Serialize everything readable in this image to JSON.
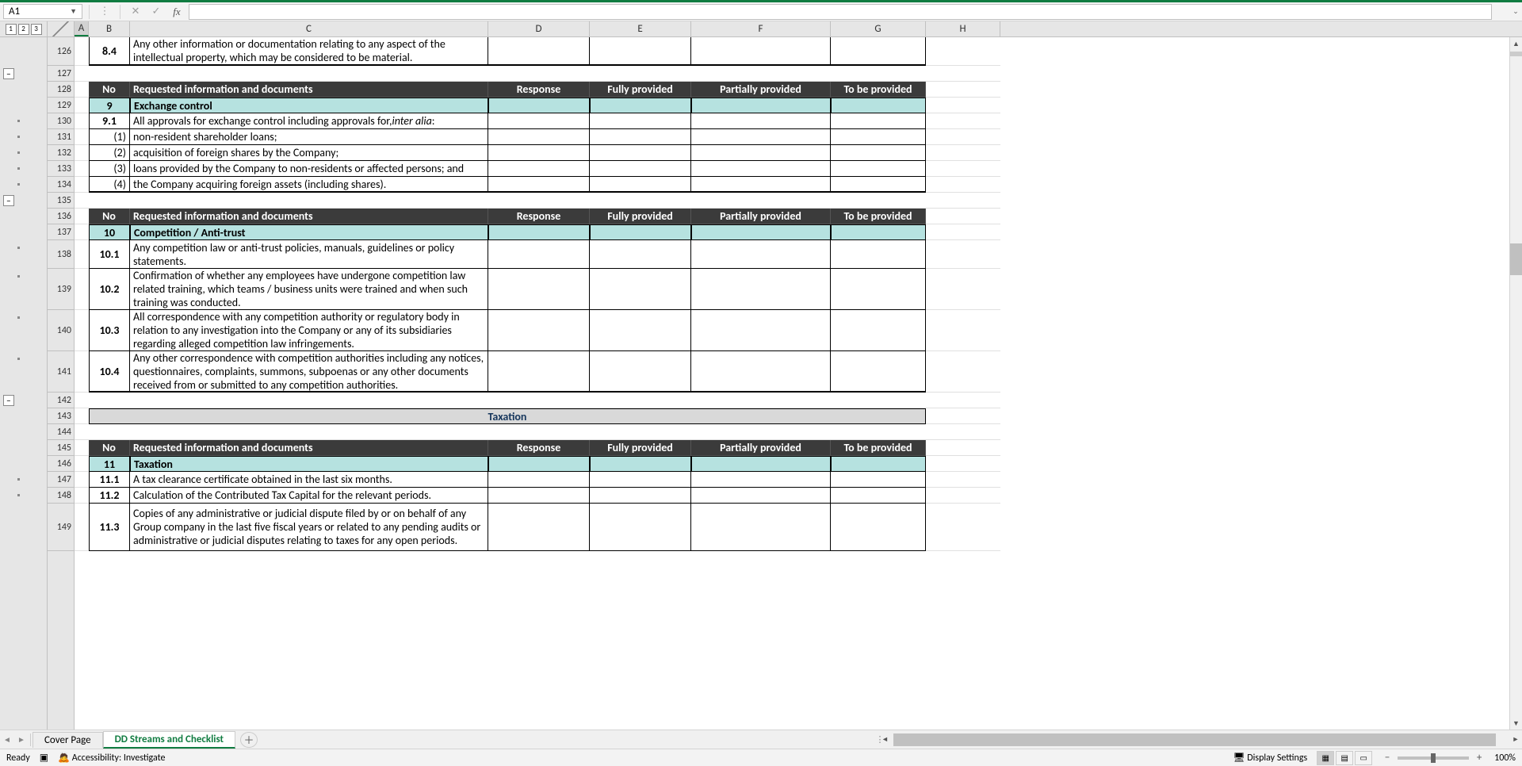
{
  "nameBox": "A1",
  "formula": "",
  "outlineLevels": [
    "1",
    "2",
    "3"
  ],
  "columns": [
    "A",
    "B",
    "C",
    "D",
    "E",
    "F",
    "G",
    "H"
  ],
  "rows": [
    126,
    127,
    128,
    129,
    130,
    131,
    132,
    133,
    134,
    135,
    136,
    137,
    138,
    139,
    140,
    141,
    142,
    143,
    144,
    145,
    146,
    147,
    148,
    149
  ],
  "rowHeights": {
    "126": 36,
    "127": 20,
    "128": 20,
    "129": 20,
    "130": 20,
    "131": 20,
    "132": 20,
    "133": 20,
    "134": 20,
    "135": 20,
    "136": 20,
    "137": 20,
    "138": 36,
    "139": 52,
    "140": 52,
    "141": 52,
    "142": 20,
    "143": 20,
    "144": 20,
    "145": 20,
    "146": 20,
    "147": 20,
    "148": 20,
    "149": 60
  },
  "cells": {
    "r126_B": "8.4",
    "r126_C": "Any other information or documentation relating to any aspect of the intellectual property, which may be considered to be material.",
    "r128_B": "No",
    "r128_C": "Requested information and documents",
    "r128_D": "Response",
    "r128_E": "Fully provided",
    "r128_F": "Partially provided",
    "r128_G": "To be provided",
    "r129_B": "9",
    "r129_C": "Exchange control",
    "r130_B": "9.1",
    "r130_C1": "All approvals for exchange control including approvals for, ",
    "r130_C2": "inter alia",
    "r130_C3": ":",
    "r131_B": "(1)",
    "r131_C": "non-resident shareholder loans;",
    "r132_B": "(2)",
    "r132_C": "acquisition of foreign shares by the Company;",
    "r133_B": "(3)",
    "r133_C": "loans provided by the Company to non-residents or affected persons; and",
    "r134_B": "(4)",
    "r134_C": "the Company acquiring foreign assets (including shares).",
    "r136_B": "No",
    "r136_C": "Requested information and documents",
    "r136_D": "Response",
    "r136_E": "Fully provided",
    "r136_F": "Partially provided",
    "r136_G": "To be provided",
    "r137_B": "10",
    "r137_C": "Competition / Anti-trust",
    "r138_B": "10.1",
    "r138_C": "Any competition law or anti-trust policies, manuals, guidelines or policy statements.",
    "r139_B": "10.2",
    "r139_C": "Confirmation of whether any employees have undergone competition law related training, which teams / business units were trained and when such training was conducted.",
    "r140_B": "10.3",
    "r140_C": " All correspondence with any competition authority or regulatory body in relation to any investigation into the Company or any of its subsidiaries regarding alleged competition law infringements.",
    "r141_B": "10.4",
    "r141_C": " Any other correspondence with competition authorities including any notices, questionnaires, complaints, summons, subpoenas or any other documents received from or submitted to any competition authorities.",
    "r143_banner": "Taxation",
    "r145_B": "No",
    "r145_C": "Requested information and documents",
    "r145_D": "Response",
    "r145_E": "Fully provided",
    "r145_F": "Partially provided",
    "r145_G": "To be provided",
    "r146_B": "11",
    "r146_C": "Taxation",
    "r147_B": "11.1",
    "r147_C": "A tax clearance certificate obtained in the last six months.",
    "r148_B": "11.2",
    "r148_C": "Calculation of the Contributed Tax Capital for the relevant periods.",
    "r149_B": "11.3",
    "r149_C": "Copies of any administrative or judicial dispute filed by or on behalf of any Group company in the last five fiscal years or related to any pending audits or administrative or judicial disputes relating to taxes for any open periods."
  },
  "outlineButtons": [
    {
      "row": 127,
      "sym": "−"
    },
    {
      "row": 135,
      "sym": "−"
    },
    {
      "row": 142,
      "sym": "−"
    }
  ],
  "outlineDots": [
    130,
    131,
    132,
    133,
    134,
    138,
    139,
    140,
    141,
    147,
    148
  ],
  "sheets": {
    "tab1": "Cover Page",
    "tab2": "DD Streams and Checklist"
  },
  "status": {
    "ready": "Ready",
    "accessibility": "Accessibility: Investigate",
    "display": "Display Settings",
    "zoom": "100%"
  }
}
